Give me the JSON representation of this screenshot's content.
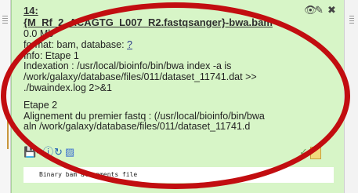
{
  "dataset": {
    "hid": "14:",
    "name": "{M_Rf_2_ACAGTG_L007_R2.fastqsanger}-bwa.bam",
    "size": "0.0 Mb",
    "format_line": "format: bam, database:",
    "database_link": "?",
    "info_lines": [
      "Info: Etape 1",
      "Indexation : /usr/local/bioinfo/bin/bwa index -a is",
      "/work/galaxy/database/files/011/dataset_11741.dat >>",
      "./bwaindex.log 2>&1",
      "Etape 2",
      "Alignement du premier fastq : (/usr/local/bioinfo/bin/bwa",
      "aln /work/galaxy/database/files/011/dataset_11741.d"
    ],
    "peek_text": "Binary bam alignments file"
  },
  "icons": {
    "eye": "eye-icon",
    "pencil": "pencil-icon",
    "delete": "delete-icon",
    "save": "disk-icon",
    "dropdown": "caret-icon",
    "info": "info-icon",
    "rerun": "rerun-icon",
    "visualize": "chart-icon",
    "check": "check-icon",
    "annotate": "note-icon"
  },
  "glyphs": {
    "eye": "👁",
    "pencil": "✎",
    "delete": "✖",
    "save": "💾",
    "caret": "▾",
    "info": "ⓘ",
    "rerun": "↻",
    "visualize": "▨",
    "check": "✓"
  },
  "colors": {
    "item_background": "#d7f5c7",
    "highlight_ellipse": "#c20d10"
  }
}
